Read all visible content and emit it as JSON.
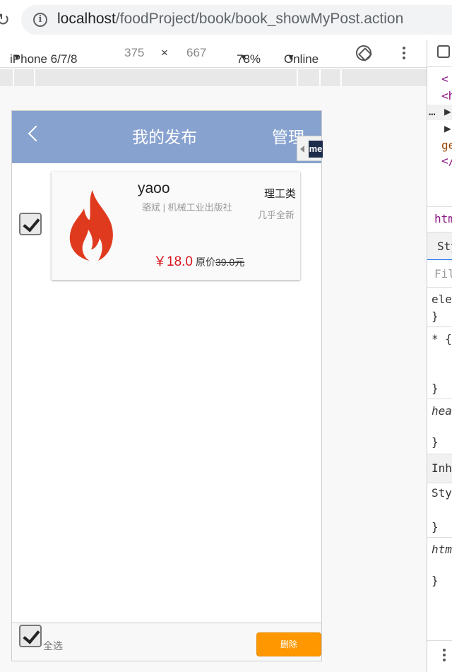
{
  "browser": {
    "url_host": "localhost",
    "url_path": "/foodProject/book/book_showMyPost.action"
  },
  "device_toolbar": {
    "device": "iPhone 6/7/8",
    "width": "375",
    "times": "×",
    "height": "667",
    "zoom": "78%",
    "network": "Online"
  },
  "devtools": {
    "lines": [
      "<",
      "<h",
      "▶",
      "▶",
      "ge",
      "</"
    ],
    "tab": "htm",
    "styles_tab": "Sty",
    "filter_placeholder": "Filt",
    "rules": [
      "ele",
      "}",
      "* {",
      "}",
      "hea",
      "}",
      "Inhe",
      "Sty",
      "}",
      "htm",
      "}"
    ]
  },
  "header": {
    "title": "我的发布",
    "manage_label": "管理"
  },
  "extension_tab": {
    "logo": "me"
  },
  "post": {
    "checked": true,
    "title": "yaoo",
    "meta": "骆斌 | 机械工业出版社",
    "category": "理工类",
    "condition": "几乎全新",
    "price": "￥18.0",
    "original_price_prefix": "原价",
    "original_price": "39.0元",
    "image_icon": "flame-icon",
    "accent_color": "#d9161e"
  },
  "footer": {
    "select_all_label": "全选",
    "delete_label": "删除",
    "delete_color": "#ff9800"
  }
}
